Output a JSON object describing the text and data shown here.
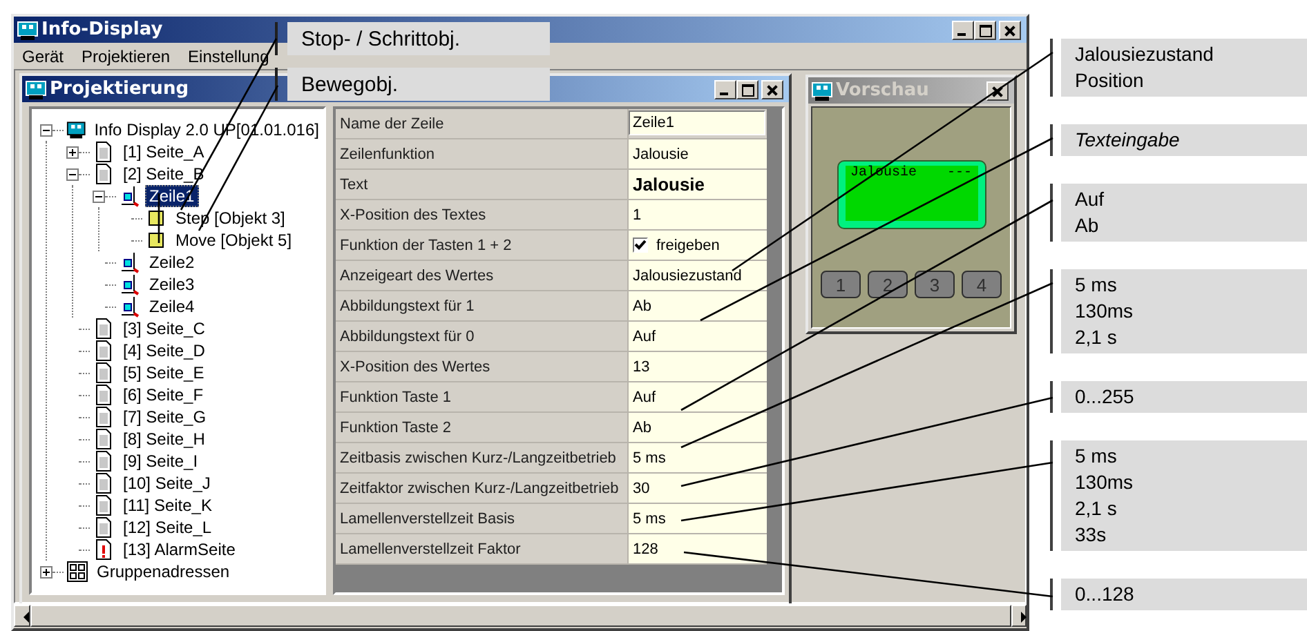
{
  "window": {
    "title": "Info-Display"
  },
  "menu": [
    "Gerät",
    "Projektieren",
    "Einstellung"
  ],
  "project_window": {
    "title": "Projektierung"
  },
  "tree": [
    {
      "label": "Info Display 2.0 UP[01.01.016]",
      "kind": "device",
      "expanded": true,
      "selected": false,
      "children": [
        {
          "label": "[1] Seite_A",
          "kind": "page",
          "expanded": false,
          "selected": false
        },
        {
          "label": "[2] Seite_B",
          "kind": "page",
          "expanded": true,
          "selected": false,
          "children": [
            {
              "label": "Zeile1",
              "kind": "line",
              "expanded": true,
              "selected": true,
              "children": [
                {
                  "label": "Step [Objekt 3]",
                  "kind": "object",
                  "selected": false
                },
                {
                  "label": "Move [Objekt 5]",
                  "kind": "object",
                  "selected": false
                }
              ]
            },
            {
              "label": "Zeile2",
              "kind": "line",
              "selected": false
            },
            {
              "label": "Zeile3",
              "kind": "line",
              "selected": false
            },
            {
              "label": "Zeile4",
              "kind": "line",
              "selected": false
            }
          ]
        },
        {
          "label": "[3] Seite_C",
          "kind": "page",
          "selected": false
        },
        {
          "label": "[4] Seite_D",
          "kind": "page",
          "selected": false
        },
        {
          "label": "[5] Seite_E",
          "kind": "page",
          "selected": false
        },
        {
          "label": "[6] Seite_F",
          "kind": "page",
          "selected": false
        },
        {
          "label": "[7] Seite_G",
          "kind": "page",
          "selected": false
        },
        {
          "label": "[8] Seite_H",
          "kind": "page",
          "selected": false
        },
        {
          "label": "[9] Seite_I",
          "kind": "page",
          "selected": false
        },
        {
          "label": "[10] Seite_J",
          "kind": "page",
          "selected": false
        },
        {
          "label": "[11] Seite_K",
          "kind": "page",
          "selected": false
        },
        {
          "label": "[12] Seite_L",
          "kind": "page",
          "selected": false
        },
        {
          "label": "[13] AlarmSeite",
          "kind": "alarm",
          "selected": false
        }
      ]
    },
    {
      "label": "Gruppenadressen",
      "kind": "group",
      "expanded": false,
      "selected": false
    }
  ],
  "properties": [
    {
      "name": "Name der Zeile",
      "value": "Zeile1",
      "kind": "field"
    },
    {
      "name": "Zeilenfunktion",
      "value": "Jalousie",
      "kind": "text"
    },
    {
      "name": "Text",
      "value": "Jalousie",
      "kind": "bold"
    },
    {
      "name": "X-Position des Textes",
      "value": "1",
      "kind": "text"
    },
    {
      "name": "Funktion der Tasten 1 + 2",
      "value": "freigeben",
      "kind": "checkbox",
      "checked": true
    },
    {
      "name": "Anzeigeart des Wertes",
      "value": "Jalousiezustand",
      "kind": "text"
    },
    {
      "name": "Abbildungstext für 1",
      "value": "Ab",
      "kind": "text"
    },
    {
      "name": "Abbildungstext für 0",
      "value": "Auf",
      "kind": "text"
    },
    {
      "name": "X-Position des Wertes",
      "value": "13",
      "kind": "text"
    },
    {
      "name": "Funktion Taste 1",
      "value": "Auf",
      "kind": "text"
    },
    {
      "name": "Funktion Taste 2",
      "value": "Ab",
      "kind": "text"
    },
    {
      "name": "Zeitbasis zwischen Kurz-/Langzeitbetrieb",
      "value": "5 ms",
      "kind": "text"
    },
    {
      "name": "Zeitfaktor zwischen Kurz-/Langzeitbetrieb",
      "value": "30",
      "kind": "text"
    },
    {
      "name": "Lamellenverstellzeit Basis",
      "value": "5 ms",
      "kind": "text"
    },
    {
      "name": "Lamellenverstellzeit Faktor",
      "value": "128",
      "kind": "text"
    }
  ],
  "preview": {
    "title": "Vorschau",
    "lcd_text": "Jalousie",
    "lcd_value": "---",
    "keys": [
      "1",
      "2",
      "3",
      "4"
    ]
  },
  "object_callouts": [
    "Stop- / Schrittobj.",
    "Bewegobj."
  ],
  "callouts": [
    {
      "lines": [
        "Jalousiezustand",
        "Position"
      ],
      "italic": false
    },
    {
      "lines": [
        "Texteingabe"
      ],
      "italic": true
    },
    {
      "lines": [
        "Auf",
        "Ab"
      ],
      "italic": false
    },
    {
      "lines": [
        "5 ms",
        "130ms",
        "2,1 s"
      ],
      "italic": false
    },
    {
      "lines": [
        "0...255"
      ],
      "italic": false
    },
    {
      "lines": [
        "5 ms",
        "130ms",
        "2,1 s",
        "33s"
      ],
      "italic": false
    },
    {
      "lines": [
        "0...128"
      ],
      "italic": false
    }
  ]
}
